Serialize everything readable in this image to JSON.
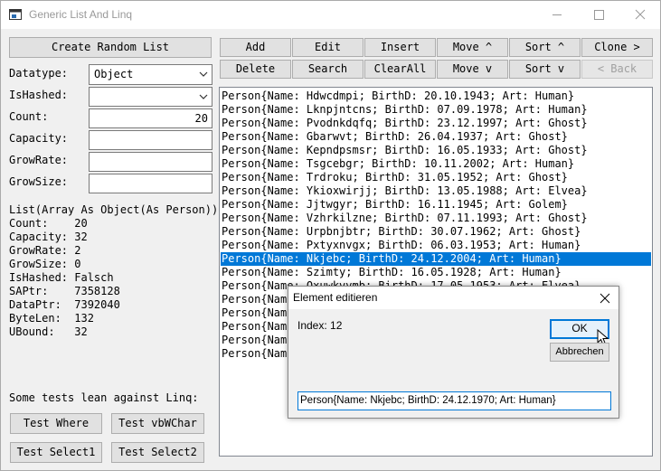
{
  "window": {
    "title": "Generic List And Linq",
    "controls": [
      "minimize-icon",
      "maximize-icon",
      "close-icon"
    ]
  },
  "left": {
    "create_button": "Create Random List",
    "fields": {
      "datatype_label": "Datatype:",
      "datatype_value": "Object",
      "ishashed_label": "IsHashed:",
      "ishashed_value": "",
      "count_label": "Count:",
      "count_value": "20",
      "capacity_label": "Capacity:",
      "capacity_value": "",
      "growrate_label": "GrowRate:",
      "growrate_value": "",
      "growsize_label": "GrowSize:",
      "growsize_value": ""
    },
    "info_header": "List(Array As Object(As Person))",
    "info_lines": [
      "Count:    20",
      "Capacity: 32",
      "GrowRate: 2",
      "GrowSize: 0",
      "IsHashed: Falsch",
      "SAPtr:    7358128",
      "DataPtr:  7392040",
      "ByteLen:  132",
      "UBound:   32"
    ],
    "linq_note": "Some tests lean against Linq:",
    "test_buttons": [
      "Test Where",
      "Test vbWChar",
      "Test Select1",
      "Test Select2"
    ]
  },
  "toolbar": {
    "row1": [
      "Add",
      "Edit",
      "Insert",
      "Move ^",
      "Sort ^",
      "Clone >"
    ],
    "row2": [
      "Delete",
      "Search",
      "ClearAll",
      "Move v",
      "Sort v",
      "< Back"
    ]
  },
  "list": {
    "selected_index": 12,
    "items": [
      "Person{Name: Hdwcdmpi; BirthD: 20.10.1943; Art: Human}",
      "Person{Name: Lknpjntcns; BirthD: 07.09.1978; Art: Human}",
      "Person{Name: Pvodnkdqfq; BirthD: 23.12.1997; Art: Ghost}",
      "Person{Name: Gbarwvt; BirthD: 26.04.1937; Art: Ghost}",
      "Person{Name: Kepndpsmsr; BirthD: 16.05.1933; Art: Ghost}",
      "Person{Name: Tsgcebgr; BirthD: 10.11.2002; Art: Human}",
      "Person{Name: Trdroku; BirthD: 31.05.1952; Art: Ghost}",
      "Person{Name: Ykioxwirjj; BirthD: 13.05.1988; Art: Elvea}",
      "Person{Name: Jjtwgyr; BirthD: 16.11.1945; Art: Golem}",
      "Person{Name: Vzhrkilzne; BirthD: 07.11.1993; Art: Ghost}",
      "Person{Name: Urpbnjbtr; BirthD: 30.07.1962; Art: Ghost}",
      "Person{Name: Pxtyxnvgx; BirthD: 06.03.1953; Art: Human}",
      "Person{Name: Nkjebc; BirthD: 24.12.2004; Art: Human}",
      "Person{Name: Szimty; BirthD: 16.05.1928; Art: Human}",
      "Person{Name: Oxuwkvvmb; BirthD: 17.05.1953; Art: Elvea}",
      "Person{Name",
      "Person{Name",
      "Person{Name",
      "Person{Name",
      "Person{Name"
    ]
  },
  "dialog": {
    "title": "Element editieren",
    "index_text": "Index: 12",
    "ok": "OK",
    "cancel": "Abbrechen",
    "input_value": "Person{Name: Nkjebc; BirthD: 24.12.1970; Art: Human}"
  }
}
